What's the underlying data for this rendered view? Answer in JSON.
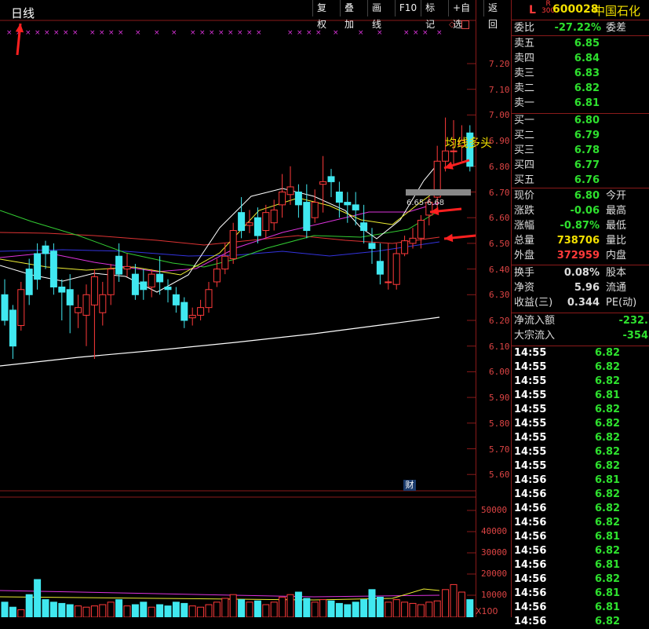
{
  "chart": {
    "period_title": "日线",
    "annotation_label": "均线多头",
    "range_label": "6.65-6.68",
    "finance_marker": "财",
    "volume_unit": "X100",
    "price_ticks": [
      "7.20",
      "7.10",
      "7.00",
      "6.90",
      "6.80",
      "6.70",
      "6.60",
      "6.50",
      "6.40",
      "6.30",
      "6.20",
      "6.10",
      "6.00",
      "5.90",
      "5.80",
      "5.70",
      "5.60"
    ],
    "volume_ticks": [
      "50000",
      "40000",
      "30000",
      "20000",
      "10000"
    ]
  },
  "toolbar": {
    "items": [
      "复权",
      "叠加",
      "画线",
      "F10",
      "标记",
      "+自选",
      "返回"
    ]
  },
  "quote": {
    "market_tag": "L",
    "index_tag_top": "R",
    "index_tag_bottom": "300",
    "code": "600028",
    "name": "中国石化",
    "weibi_label": "委比",
    "weibi_value": "-27.22%",
    "weicha_label": "委差",
    "sell": [
      {
        "label": "卖五",
        "price": "6.85"
      },
      {
        "label": "卖四",
        "price": "6.84"
      },
      {
        "label": "卖三",
        "price": "6.83"
      },
      {
        "label": "卖二",
        "price": "6.82"
      },
      {
        "label": "卖一",
        "price": "6.81"
      }
    ],
    "buy": [
      {
        "label": "买一",
        "price": "6.80"
      },
      {
        "label": "买二",
        "price": "6.79"
      },
      {
        "label": "买三",
        "price": "6.78"
      },
      {
        "label": "买四",
        "price": "6.77"
      },
      {
        "label": "买五",
        "price": "6.76"
      }
    ],
    "stats": [
      {
        "label": "现价",
        "value": "6.80",
        "label2": "今开"
      },
      {
        "label": "涨跌",
        "value": "-0.06",
        "label2": "最高"
      },
      {
        "label": "涨幅",
        "value": "-0.87%",
        "label2": "最低"
      },
      {
        "label": "总量",
        "value": "738706",
        "label2": "量比"
      },
      {
        "label": "外盘",
        "value": "372959",
        "label2": "内盘"
      }
    ],
    "stats2": [
      {
        "label": "换手",
        "value": "0.08%",
        "label2": "股本"
      },
      {
        "label": "净资",
        "value": "5.96",
        "label2": "流通"
      },
      {
        "label": "收益(三)",
        "value": "0.344",
        "label2": "PE(动)"
      }
    ],
    "flow": [
      {
        "label": "净流入额",
        "value": "-232."
      },
      {
        "label": "大宗流入",
        "value": "-354"
      }
    ],
    "ticks": [
      {
        "time": "14:55",
        "price": "6.82"
      },
      {
        "time": "14:55",
        "price": "6.82"
      },
      {
        "time": "14:55",
        "price": "6.82"
      },
      {
        "time": "14:55",
        "price": "6.81"
      },
      {
        "time": "14:55",
        "price": "6.82"
      },
      {
        "time": "14:55",
        "price": "6.82"
      },
      {
        "time": "14:55",
        "price": "6.82"
      },
      {
        "time": "14:55",
        "price": "6.82"
      },
      {
        "time": "14:55",
        "price": "6.82"
      },
      {
        "time": "14:56",
        "price": "6.81"
      },
      {
        "time": "14:56",
        "price": "6.82"
      },
      {
        "time": "14:56",
        "price": "6.82"
      },
      {
        "time": "14:56",
        "price": "6.82"
      },
      {
        "time": "14:56",
        "price": "6.81"
      },
      {
        "time": "14:56",
        "price": "6.82"
      },
      {
        "time": "14:56",
        "price": "6.81"
      },
      {
        "time": "14:56",
        "price": "6.82"
      },
      {
        "time": "14:56",
        "price": "6.81"
      },
      {
        "time": "14:56",
        "price": "6.81"
      },
      {
        "time": "14:56",
        "price": "6.82"
      }
    ]
  },
  "colors": {
    "up": "#ff3a3a",
    "down": "#40e8f0",
    "price_green": "#2ee02e",
    "value_yellow": "#f2e000",
    "grid": "#8a1a1a"
  }
}
